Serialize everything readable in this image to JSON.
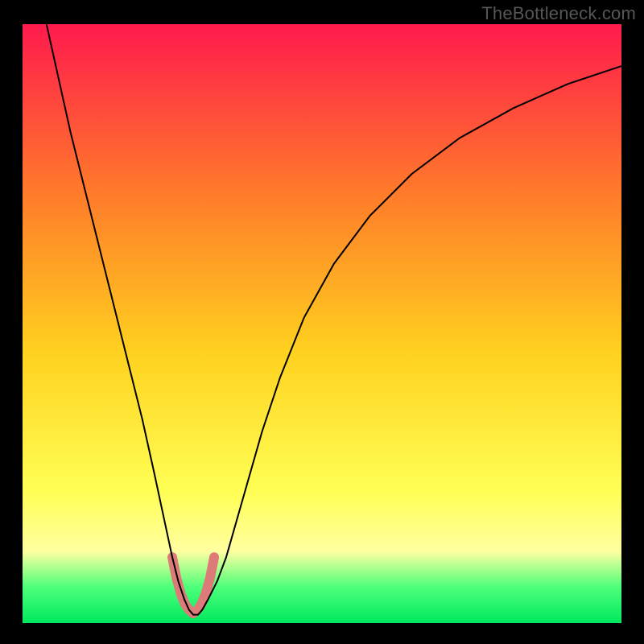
{
  "watermark": "TheBottleneck.com",
  "chart_data": {
    "type": "line",
    "title": "",
    "xlabel": "",
    "ylabel": "",
    "xlim": [
      0,
      100
    ],
    "ylim": [
      0,
      100
    ],
    "grid": false,
    "legend": false,
    "background_gradient": {
      "top": "#ff1a4d",
      "mid_upper": "#ff7a2a",
      "mid": "#ffd21f",
      "mid_lower": "#ffff55",
      "low_band": "#ffffa0",
      "green_band": "#4dff7a",
      "bottom": "#00e85e"
    },
    "series": [
      {
        "name": "main-curve",
        "color": "#000000",
        "stroke_width": 2,
        "x": [
          4,
          6,
          8,
          10,
          12,
          14,
          16,
          18,
          20,
          22,
          23.5,
          25,
          26,
          27,
          27.8,
          28.5,
          29.3,
          30,
          31,
          32.5,
          34,
          36,
          38,
          40,
          43,
          47,
          52,
          58,
          65,
          73,
          82,
          91,
          100
        ],
        "y": [
          100,
          91,
          82,
          74,
          66,
          58,
          50,
          42,
          34,
          25,
          18,
          11,
          7,
          4,
          2.2,
          1.4,
          1.4,
          2.2,
          4,
          7,
          11,
          18,
          25,
          32,
          41,
          51,
          60,
          68,
          75,
          81,
          86,
          90,
          93
        ]
      },
      {
        "name": "trough-highlight",
        "color": "#dd7b79",
        "stroke_width": 12,
        "linecap": "round",
        "x": [
          25.0,
          25.7,
          26.4,
          27.1,
          27.8,
          28.5,
          29.2,
          29.9,
          30.6,
          31.3,
          32.0
        ],
        "y": [
          11.0,
          7.5,
          5.0,
          3.2,
          2.2,
          1.6,
          2.2,
          3.2,
          5.0,
          7.5,
          11.0
        ]
      }
    ]
  }
}
